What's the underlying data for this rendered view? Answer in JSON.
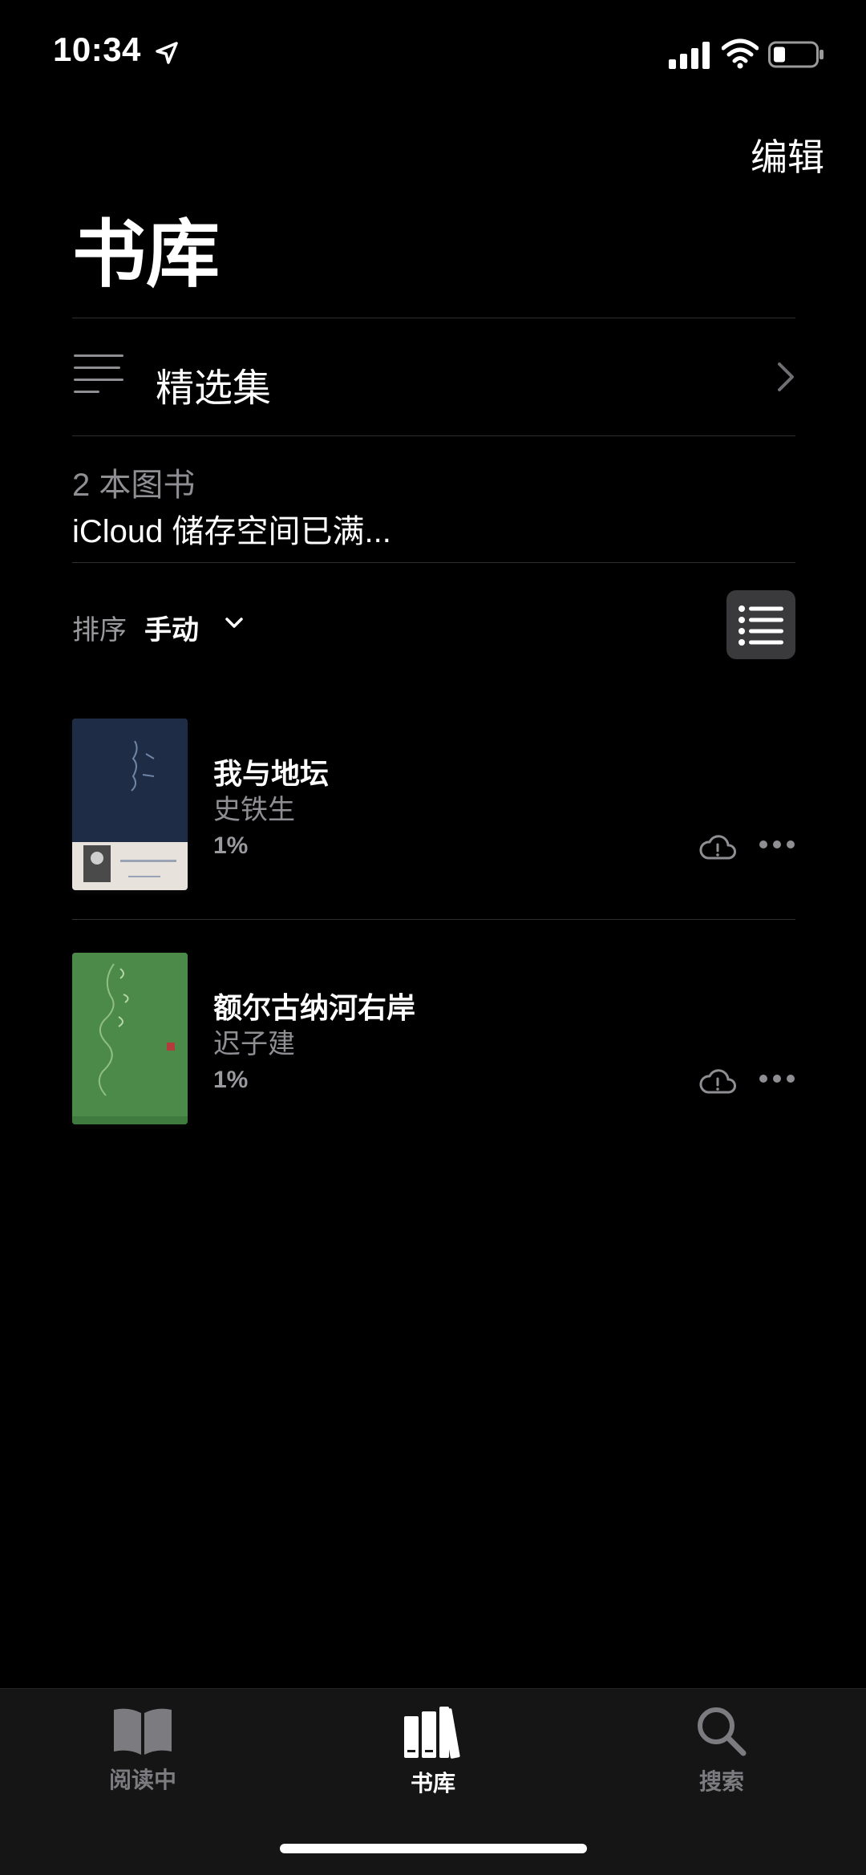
{
  "status": {
    "time": "10:34"
  },
  "header": {
    "edit_label": "编辑",
    "title": "书库"
  },
  "collections": {
    "label": "精选集"
  },
  "summary": {
    "count": "2 本图书",
    "icloud": "iCloud 储存空间已满..."
  },
  "sort": {
    "label": "排序",
    "value": "手动"
  },
  "books": [
    {
      "title": "我与地坛",
      "author": "史铁生",
      "progress": "1%",
      "cover_color": "#1f2c45"
    },
    {
      "title": "额尔古纳河右岸",
      "author": "迟子建",
      "progress": "1%",
      "cover_color": "#4c8a4a"
    }
  ],
  "tabs": [
    {
      "label": "阅读中",
      "icon": "book-open-icon",
      "active": false
    },
    {
      "label": "书库",
      "icon": "library-books-icon",
      "active": true
    },
    {
      "label": "搜索",
      "icon": "search-icon",
      "active": false
    }
  ],
  "colors": {
    "background": "#000000",
    "secondary_text": "#8e8e93",
    "tabbar": "#151515"
  }
}
